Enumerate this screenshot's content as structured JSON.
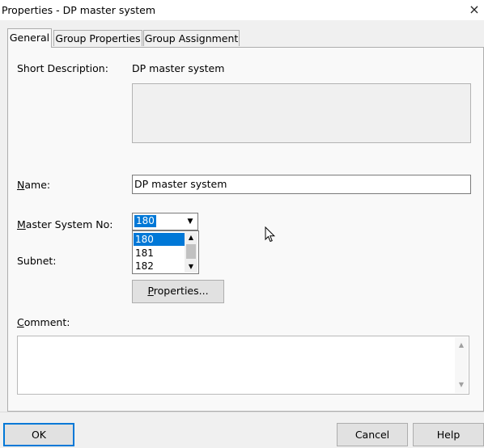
{
  "window": {
    "title": "Properties - DP master system",
    "close_symbol": "×"
  },
  "tabs": [
    {
      "label": "General",
      "active": true
    },
    {
      "label": "Group Properties",
      "active": false
    },
    {
      "label": "Group Assignment",
      "active": false
    }
  ],
  "general": {
    "short_description_label": "Short Description:",
    "short_description_value": "DP master system",
    "name_label_key": "N",
    "name_label_rest": "ame:",
    "name_value": "DP master system",
    "master_system_label_key": "M",
    "master_system_label_rest": "aster System No:",
    "master_system_value": "180",
    "master_system_options": [
      "180",
      "181",
      "182"
    ],
    "subnet_label": "Subnet:",
    "properties_button_key": "P",
    "properties_button_rest": "roperties...",
    "comment_label_key": "C",
    "comment_label_rest": "omment:",
    "comment_value": ""
  },
  "buttons": {
    "ok": "OK",
    "cancel": "Cancel",
    "help": "Help"
  },
  "colors": {
    "selection": "#0078d7",
    "dialog_bg": "#f0f0f0",
    "panel_bg": "#f9f9f9"
  }
}
